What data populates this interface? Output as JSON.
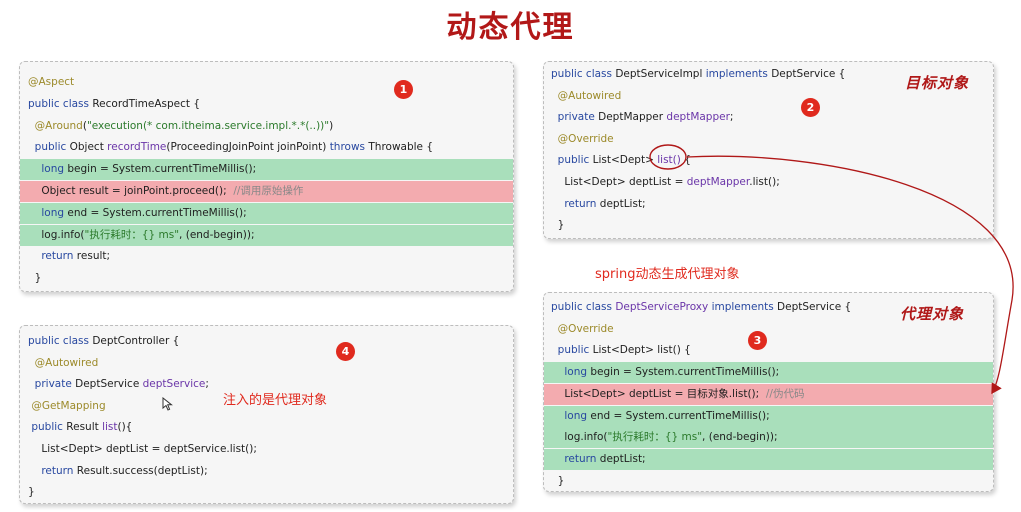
{
  "title": "动态代理",
  "panels": {
    "aspect": {
      "badge": "1",
      "lines": [
        [
          {
            "t": "@Aspect",
            "c": "ann"
          }
        ],
        [
          {
            "t": "public class ",
            "c": "k"
          },
          {
            "t": "RecordTimeAspect {"
          }
        ],
        [
          {
            "t": "  @Around",
            "c": "ann"
          },
          {
            "t": "("
          },
          {
            "t": "\"execution(* com.itheima.service.impl.*.*(..))\"",
            "c": "s"
          },
          {
            "t": ")"
          }
        ],
        [
          {
            "t": "  public ",
            "c": "k"
          },
          {
            "t": "Object "
          },
          {
            "t": "recordTime",
            "c": "m"
          },
          {
            "t": "(ProceedingJoinPoint joinPoint) "
          },
          {
            "t": "throws ",
            "c": "k"
          },
          {
            "t": "Throwable {"
          }
        ],
        [
          {
            "t": "    long ",
            "c": "k"
          },
          {
            "t": "begin = System.currentTimeMillis();"
          }
        ],
        [
          {
            "t": "    Object result = joinPoint.proceed();  "
          },
          {
            "t": "//调用原始操作",
            "c": "c"
          }
        ],
        [
          {
            "t": "    long ",
            "c": "k"
          },
          {
            "t": "end = System.currentTimeMillis();"
          }
        ],
        [
          {
            "t": "    log.info("
          },
          {
            "t": "\"执行耗时：{} ms\"",
            "c": "s"
          },
          {
            "t": ", (end-begin));"
          }
        ],
        [
          {
            "t": "    return ",
            "c": "k"
          },
          {
            "t": "result;"
          }
        ],
        [
          {
            "t": "  }"
          }
        ]
      ],
      "highlights": [
        "",
        "",
        "",
        "",
        "green",
        "red",
        "green",
        "green",
        "",
        ""
      ]
    },
    "impl": {
      "badge": "2",
      "label": "目标对象",
      "lines": [
        [
          {
            "t": "public class ",
            "c": "k"
          },
          {
            "t": "DeptServiceImpl "
          },
          {
            "t": "implements ",
            "c": "k"
          },
          {
            "t": "DeptService {"
          }
        ],
        [
          {
            "t": "  @Autowired",
            "c": "ann"
          }
        ],
        [
          {
            "t": "  private ",
            "c": "k"
          },
          {
            "t": "DeptMapper "
          },
          {
            "t": "deptMapper",
            "c": "m"
          },
          {
            "t": ";"
          }
        ],
        [
          {
            "t": "  @Override",
            "c": "ann"
          }
        ],
        [
          {
            "t": "  public ",
            "c": "k"
          },
          {
            "t": "List<Dept> "
          },
          {
            "t": "list()",
            "c": "m"
          },
          {
            "t": " {"
          }
        ],
        [
          {
            "t": "    List<Dept> deptList = "
          },
          {
            "t": "deptMapper",
            "c": "m"
          },
          {
            "t": ".list();"
          }
        ],
        [
          {
            "t": "    return ",
            "c": "k"
          },
          {
            "t": "deptList;"
          }
        ],
        [
          {
            "t": "  }"
          }
        ]
      ]
    },
    "controller": {
      "badge": "4",
      "note": "注入的是代理对象",
      "lines": [
        [
          {
            "t": "public class ",
            "c": "k"
          },
          {
            "t": "DeptController {"
          }
        ],
        [
          {
            "t": "  @Autowired",
            "c": "ann"
          }
        ],
        [
          {
            "t": "  private ",
            "c": "k"
          },
          {
            "t": "DeptService "
          },
          {
            "t": "deptService",
            "c": "m"
          },
          {
            "t": ";"
          }
        ],
        [
          {
            "t": " @GetMapping",
            "c": "ann"
          }
        ],
        [
          {
            "t": " public ",
            "c": "k"
          },
          {
            "t": "Result "
          },
          {
            "t": "list",
            "c": "m"
          },
          {
            "t": "(){"
          }
        ],
        [
          {
            "t": "    List<Dept> deptList = deptService.list();"
          }
        ],
        [
          {
            "t": "    return ",
            "c": "k"
          },
          {
            "t": "Result.success(deptList);"
          }
        ],
        [
          {
            "t": "}"
          }
        ]
      ]
    },
    "proxy": {
      "badge": "3",
      "label": "代理对象",
      "lines": [
        [
          {
            "t": "public class ",
            "c": "k"
          },
          {
            "t": "DeptServiceProxy ",
            "c": "m"
          },
          {
            "t": "implements ",
            "c": "k"
          },
          {
            "t": "DeptService {"
          }
        ],
        [
          {
            "t": "  @Override",
            "c": "ann"
          }
        ],
        [
          {
            "t": "  public ",
            "c": "k"
          },
          {
            "t": "List<Dept> list() {"
          }
        ],
        [
          {
            "t": "    long ",
            "c": "k"
          },
          {
            "t": "begin = System.currentTimeMillis();"
          }
        ],
        [
          {
            "t": "    List<Dept> deptList = 目标对象.list();  "
          },
          {
            "t": "//伪代码",
            "c": "c"
          }
        ],
        [
          {
            "t": "    long ",
            "c": "k"
          },
          {
            "t": "end = System.currentTimeMillis();"
          }
        ],
        [
          {
            "t": "    log.info("
          },
          {
            "t": "\"执行耗时：{} ms\"",
            "c": "s"
          },
          {
            "t": ", (end-begin));"
          }
        ],
        [
          {
            "t": "    return ",
            "c": "k"
          },
          {
            "t": "deptList;"
          }
        ],
        [
          {
            "t": "  }"
          }
        ]
      ],
      "highlights": [
        "",
        "",
        "",
        "green",
        "red",
        "green",
        "green",
        "green",
        ""
      ]
    }
  },
  "middle_note": "spring动态生成代理对象",
  "colors": {
    "accent": "#e02a1e",
    "title": "#b21818",
    "green": "#a9dfbb",
    "red": "#f3abaf"
  }
}
